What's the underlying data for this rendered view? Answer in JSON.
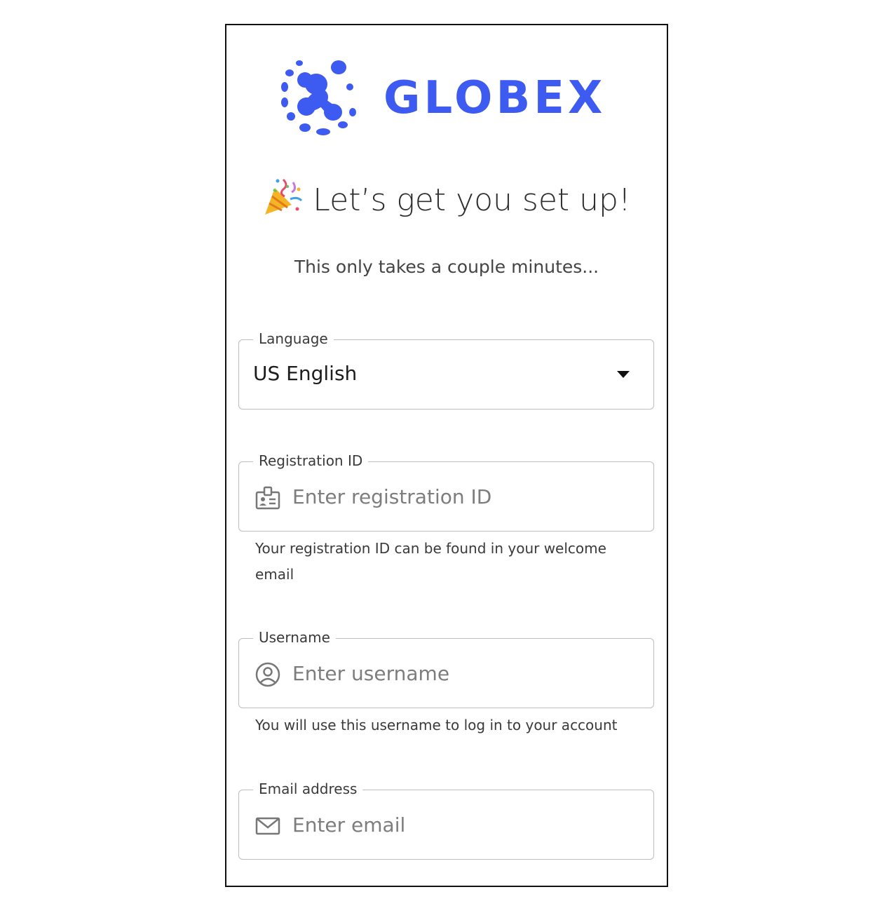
{
  "brand": {
    "name": "GLOBEX",
    "color": "#3d5af1"
  },
  "heading": {
    "emoji_icon": "party-popper-icon",
    "text": "Let’s get you set up!"
  },
  "subtext": "This only takes a couple minutes...",
  "form": {
    "language": {
      "label": "Language",
      "value": "US English"
    },
    "registration_id": {
      "label": "Registration ID",
      "placeholder": "Enter registration ID",
      "icon": "id-badge-icon",
      "helper": "Your registration ID can be found in your welcome email"
    },
    "username": {
      "label": "Username",
      "placeholder": "Enter username",
      "icon": "user-circle-icon",
      "helper": "You will use this username to log in to your account"
    },
    "email": {
      "label": "Email address",
      "placeholder": "Enter email",
      "icon": "envelope-icon"
    }
  }
}
